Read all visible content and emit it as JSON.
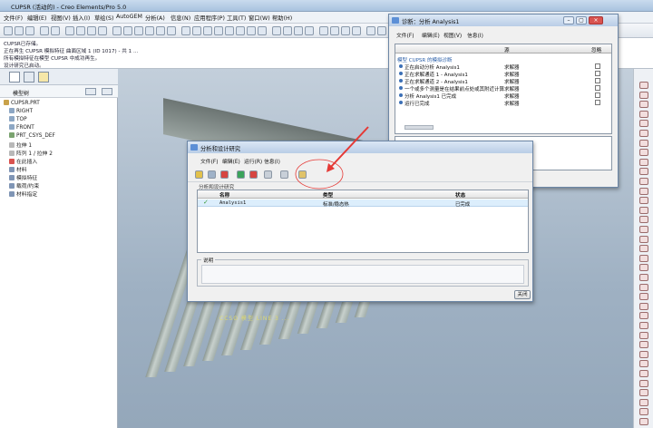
{
  "window": {
    "title": "CUPSR (活动的) - Creo Elements/Pro 5.0"
  },
  "menubar": [
    "文件(F)",
    "编辑(E)",
    "视图(V)",
    "插入(I)",
    "草绘(S)",
    "AutoGEM",
    "分析(A)",
    "信息(N)",
    "应用程序(P)",
    "工具(T)",
    "窗口(W)",
    "帮助(H)"
  ],
  "messages": [
    "CUPSR已存储。",
    "正在再生 CUPSR 模拟特征 曲面区域 1 (ID 1017) - 共 1 ...",
    "所有模拟特征在模型 CUPSR 中成功再生。",
    "设计研究已启动。"
  ],
  "tree": {
    "header": "模型树",
    "items": [
      "CUPSR.PRT",
      "RIGHT",
      "TOP",
      "FRONT",
      "PRT_CSYS_DEF",
      "拉伸 1",
      "阵列 1 / 拉伸 2",
      "在此插入",
      "材料",
      "模拟特征",
      "载荷/约束",
      "材料指定"
    ]
  },
  "graphics_label": "CCSO 模型 LINE 3 ...",
  "design_study": {
    "title": "分析和设计研究",
    "menus": [
      "文件(F)",
      "编辑(E)",
      "运行(R)",
      "信息(I)"
    ],
    "section_label": "分析和设计研究",
    "columns": [
      "名称",
      "类型",
      "状态"
    ],
    "row": {
      "name": "Analysis1",
      "type": "标准/稳态热",
      "status": "已完成"
    },
    "info_label": "说明",
    "close_label": "关闭"
  },
  "diagnostics": {
    "title": "诊断：分析 Analysis1",
    "menus": [
      "文件(F)",
      "编辑(E)",
      "视图(V)",
      "信息(I)"
    ],
    "columns": [
      "源",
      "忽略"
    ],
    "rows": [
      {
        "text": "模型 CUPSR 的模拟诊断",
        "source": ""
      },
      {
        "text": "正在启动分析 Analysis1",
        "source": "求解器"
      },
      {
        "text": "正在求解通道 1 - Analysis1",
        "source": "求解器"
      },
      {
        "text": "正在求解通道 2 - Analysis1",
        "source": "求解器"
      },
      {
        "text": "一个或多个测量是在结果前点处或其附近计算的",
        "source": "求解器"
      },
      {
        "text": "分析 Analysis1 已完成",
        "source": "求解器"
      },
      {
        "text": "运行已完成",
        "source": "求解器"
      }
    ],
    "close_label": "关闭"
  },
  "colors": {
    "accent": "#3b6fb6",
    "selected_row": "#dceefc",
    "annotation": "#e53935"
  }
}
